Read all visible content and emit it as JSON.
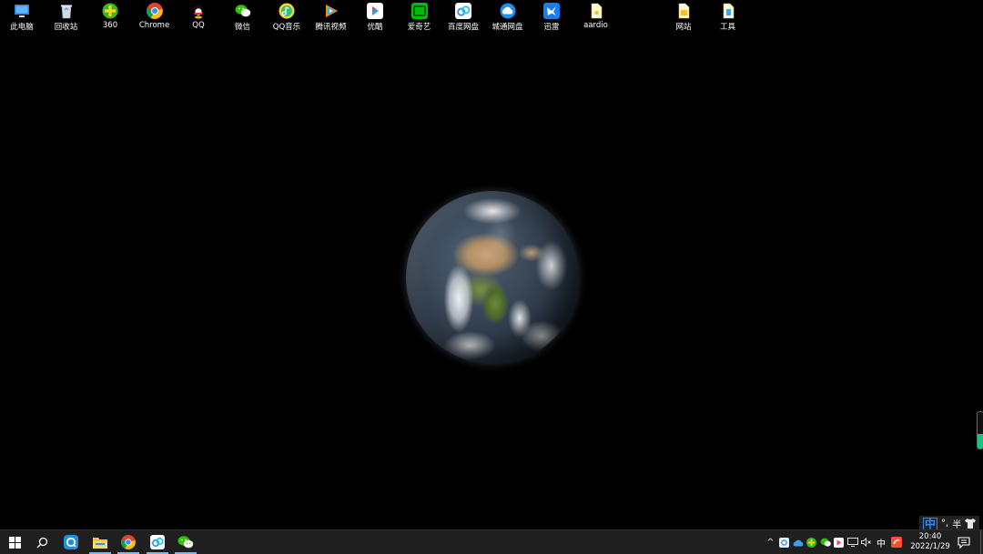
{
  "desktop": {
    "icons": [
      {
        "label": "此电脑",
        "icon": "computer-icon"
      },
      {
        "label": "回收站",
        "icon": "recycle-bin-icon"
      },
      {
        "label": "360",
        "icon": "360-icon"
      },
      {
        "label": "Chrome",
        "icon": "chrome-icon"
      },
      {
        "label": "QQ",
        "icon": "qq-icon"
      },
      {
        "label": "微信",
        "icon": "wechat-icon"
      },
      {
        "label": "QQ音乐",
        "icon": "qq-music-icon"
      },
      {
        "label": "腾讯视频",
        "icon": "tencent-video-icon"
      },
      {
        "label": "优酷",
        "icon": "youku-icon"
      },
      {
        "label": "爱奇艺",
        "icon": "iqiyi-icon"
      },
      {
        "label": "百度网盘",
        "icon": "baidu-netdisk-icon"
      },
      {
        "label": "城通网盘",
        "icon": "ctfile-icon"
      },
      {
        "label": "迅雷",
        "icon": "xunlei-icon"
      },
      {
        "label": "aardio",
        "icon": "aardio-file-icon"
      },
      {
        "label": "网站",
        "icon": "folder-icon"
      },
      {
        "label": "工具",
        "icon": "tools-file-icon"
      }
    ]
  },
  "side_meter": {
    "level": 0.4,
    "color": "#19c37d"
  },
  "ime": {
    "mode": "中",
    "punct": "°,",
    "width": "半",
    "skin_icon": "shirt-icon"
  },
  "taskbar": {
    "pinned": [
      {
        "icon": "start-icon",
        "active": false
      },
      {
        "icon": "search-icon",
        "active": false
      },
      {
        "icon": "qq-browser-icon",
        "active": false
      },
      {
        "icon": "file-explorer-icon",
        "active": true
      },
      {
        "icon": "chrome-icon",
        "active": true
      },
      {
        "icon": "baidu-netdisk-icon",
        "active": true
      },
      {
        "icon": "wechat-icon",
        "active": true
      }
    ],
    "tray": {
      "chevron": "^",
      "ime_char": "中",
      "icons": [
        "baidu-netdisk-tray-icon",
        "onedrive-icon",
        "360-tray-icon",
        "wechat-tray-icon",
        "tencent-video-tray-icon",
        "display-icon",
        "volume-muted-icon"
      ]
    },
    "clock": {
      "time": "20:40",
      "date": "2022/1/29"
    }
  },
  "colors": {
    "taskbar_bg": "#1f1f1f",
    "accent": "#76b9ed",
    "desktop_bg": "#000000"
  }
}
